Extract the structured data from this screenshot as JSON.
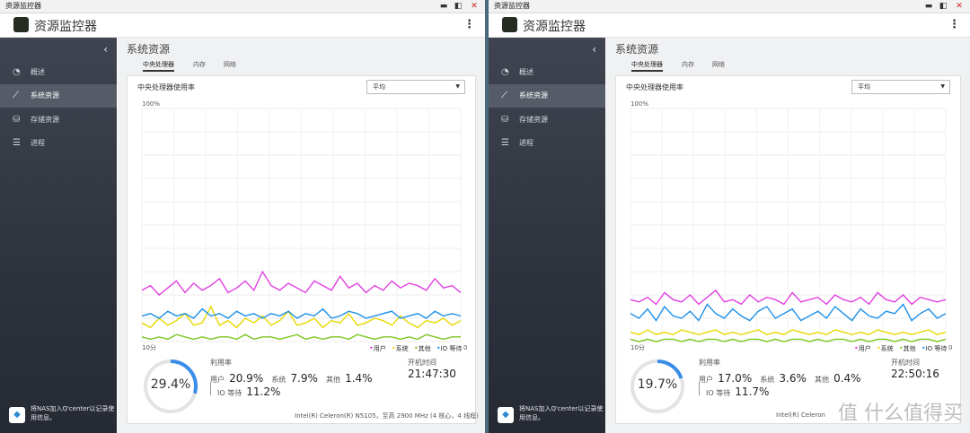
{
  "panels": [
    {
      "window_title": "资源监控器",
      "app_title": "资源监控器",
      "nav": [
        {
          "label": "概述",
          "icon": "gauge-icon"
        },
        {
          "label": "系统资源",
          "icon": "line-chart-icon"
        },
        {
          "label": "存储资源",
          "icon": "storage-icon"
        },
        {
          "label": "进程",
          "icon": "list-icon"
        }
      ],
      "qcenter_text": "将NAS加入Q'center以记录使用信息。",
      "section_title": "系统资源",
      "tabs": [
        "中央处理器",
        "内存",
        "网络"
      ],
      "card_title": "中央处理器使用率",
      "select_value": "平均",
      "y_top_label": "100%",
      "x_left_label": "10分",
      "x_right_label": "0",
      "legend": [
        {
          "label": "用户",
          "color": "#e040e0"
        },
        {
          "label": "系统",
          "color": "#e8d800"
        },
        {
          "label": "其他",
          "color": "#7cc61e"
        },
        {
          "label": "IO 等待",
          "color": "#1e90e8"
        }
      ],
      "gauge_value": "29.4%",
      "gauge_fraction": 0.294,
      "util_label": "利用率",
      "user_label": "用户",
      "user_value": "20.9%",
      "system_label": "系统",
      "system_value": "7.9%",
      "other_label": "其他",
      "other_value": "1.4%",
      "io_label": "IO 等待",
      "io_value": "11.2%",
      "uptime_label": "开机时间",
      "uptime_value": "21:47:30",
      "cpu_info": "Intel(R) Celeron(R) N5105，至高 2900 MHz (4 核心，4 线程)"
    },
    {
      "window_title": "资源监控器",
      "app_title": "资源监控器",
      "nav": [
        {
          "label": "概述",
          "icon": "gauge-icon"
        },
        {
          "label": "系统资源",
          "icon": "line-chart-icon"
        },
        {
          "label": "存储资源",
          "icon": "storage-icon"
        },
        {
          "label": "进程",
          "icon": "list-icon"
        }
      ],
      "qcenter_text": "将NAS加入Q'center以记录使用信息。",
      "section_title": "系统资源",
      "tabs": [
        "中央处理器",
        "内存",
        "网络"
      ],
      "card_title": "中央处理器使用率",
      "select_value": "平均",
      "y_top_label": "100%",
      "x_left_label": "10分",
      "x_right_label": "0",
      "legend": [
        {
          "label": "用户",
          "color": "#e040e0"
        },
        {
          "label": "系统",
          "color": "#e8d800"
        },
        {
          "label": "其他",
          "color": "#7cc61e"
        },
        {
          "label": "IO 等待",
          "color": "#1e90e8"
        }
      ],
      "gauge_value": "19.7%",
      "gauge_fraction": 0.197,
      "util_label": "利用率",
      "user_label": "用户",
      "user_value": "17.0%",
      "system_label": "系统",
      "system_value": "3.6%",
      "other_label": "其他",
      "other_value": "0.4%",
      "io_label": "IO 等待",
      "io_value": "11.7%",
      "uptime_label": "开机时间",
      "uptime_value": "22:50:16",
      "cpu_info": "Intel(R) Celeron"
    }
  ],
  "watermark": "值 什么值得买",
  "chart_data": [
    {
      "type": "line",
      "title": "中央处理器使用率",
      "ylim": [
        0,
        100
      ],
      "x_labels": [
        "10分",
        "0"
      ],
      "series": [
        {
          "name": "用户",
          "values": [
            22,
            24,
            20,
            23,
            26,
            21,
            25,
            22,
            24,
            27,
            21,
            23,
            26,
            22,
            30,
            24,
            22,
            25,
            23,
            21,
            26,
            24,
            22,
            28,
            23,
            25,
            21,
            24,
            22,
            26,
            23,
            25,
            24,
            22,
            27,
            23,
            24,
            21
          ]
        },
        {
          "name": "系统",
          "values": [
            8,
            6,
            10,
            7,
            9,
            12,
            7,
            8,
            15,
            7,
            9,
            6,
            10,
            8,
            11,
            7,
            9,
            13,
            7,
            8,
            10,
            6,
            9,
            8,
            12,
            7,
            8,
            10,
            9,
            7,
            11,
            8,
            6,
            9,
            8,
            10,
            7,
            9
          ]
        },
        {
          "name": "其他",
          "values": [
            2,
            1,
            2,
            1,
            3,
            2,
            1,
            2,
            1,
            2,
            2,
            1,
            3,
            1,
            2,
            2,
            1,
            2,
            3,
            1,
            2,
            1,
            2,
            2,
            1,
            3,
            2,
            1,
            2,
            2,
            1,
            2,
            1,
            3,
            2,
            1,
            2,
            2
          ]
        },
        {
          "name": "IO 等待",
          "values": [
            11,
            12,
            10,
            13,
            11,
            12,
            10,
            14,
            11,
            12,
            10,
            13,
            11,
            12,
            10,
            12,
            11,
            13,
            10,
            12,
            11,
            14,
            10,
            11,
            13,
            12,
            10,
            11,
            12,
            13,
            10,
            11,
            12,
            10,
            13,
            11,
            12,
            11
          ]
        }
      ]
    },
    {
      "type": "line",
      "title": "中央处理器使用率",
      "ylim": [
        0,
        100
      ],
      "x_labels": [
        "10分",
        "0"
      ],
      "series": [
        {
          "name": "用户",
          "values": [
            18,
            17,
            19,
            16,
            21,
            18,
            17,
            20,
            16,
            19,
            22,
            17,
            18,
            16,
            20,
            17,
            19,
            18,
            16,
            21,
            17,
            18,
            19,
            16,
            20,
            18,
            17,
            19,
            16,
            21,
            18,
            17,
            20,
            16,
            19,
            18,
            17,
            18
          ]
        },
        {
          "name": "系统",
          "values": [
            4,
            3,
            5,
            3,
            4,
            3,
            5,
            4,
            3,
            4,
            5,
            3,
            4,
            3,
            4,
            5,
            3,
            4,
            3,
            5,
            4,
            3,
            4,
            3,
            5,
            4,
            3,
            4,
            3,
            5,
            4,
            3,
            4,
            3,
            4,
            5,
            3,
            4
          ]
        },
        {
          "name": "其他",
          "values": [
            1,
            0,
            1,
            0,
            1,
            1,
            0,
            1,
            0,
            1,
            1,
            0,
            1,
            0,
            1,
            1,
            0,
            1,
            0,
            1,
            1,
            0,
            1,
            0,
            1,
            1,
            0,
            1,
            0,
            1,
            1,
            0,
            1,
            0,
            1,
            1,
            0,
            1
          ]
        },
        {
          "name": "IO 等待",
          "values": [
            12,
            10,
            14,
            9,
            15,
            11,
            10,
            13,
            9,
            16,
            12,
            10,
            14,
            11,
            9,
            13,
            15,
            10,
            12,
            14,
            9,
            11,
            13,
            10,
            15,
            12,
            9,
            14,
            11,
            10,
            13,
            12,
            16,
            9,
            12,
            14,
            10,
            12
          ]
        }
      ]
    }
  ]
}
